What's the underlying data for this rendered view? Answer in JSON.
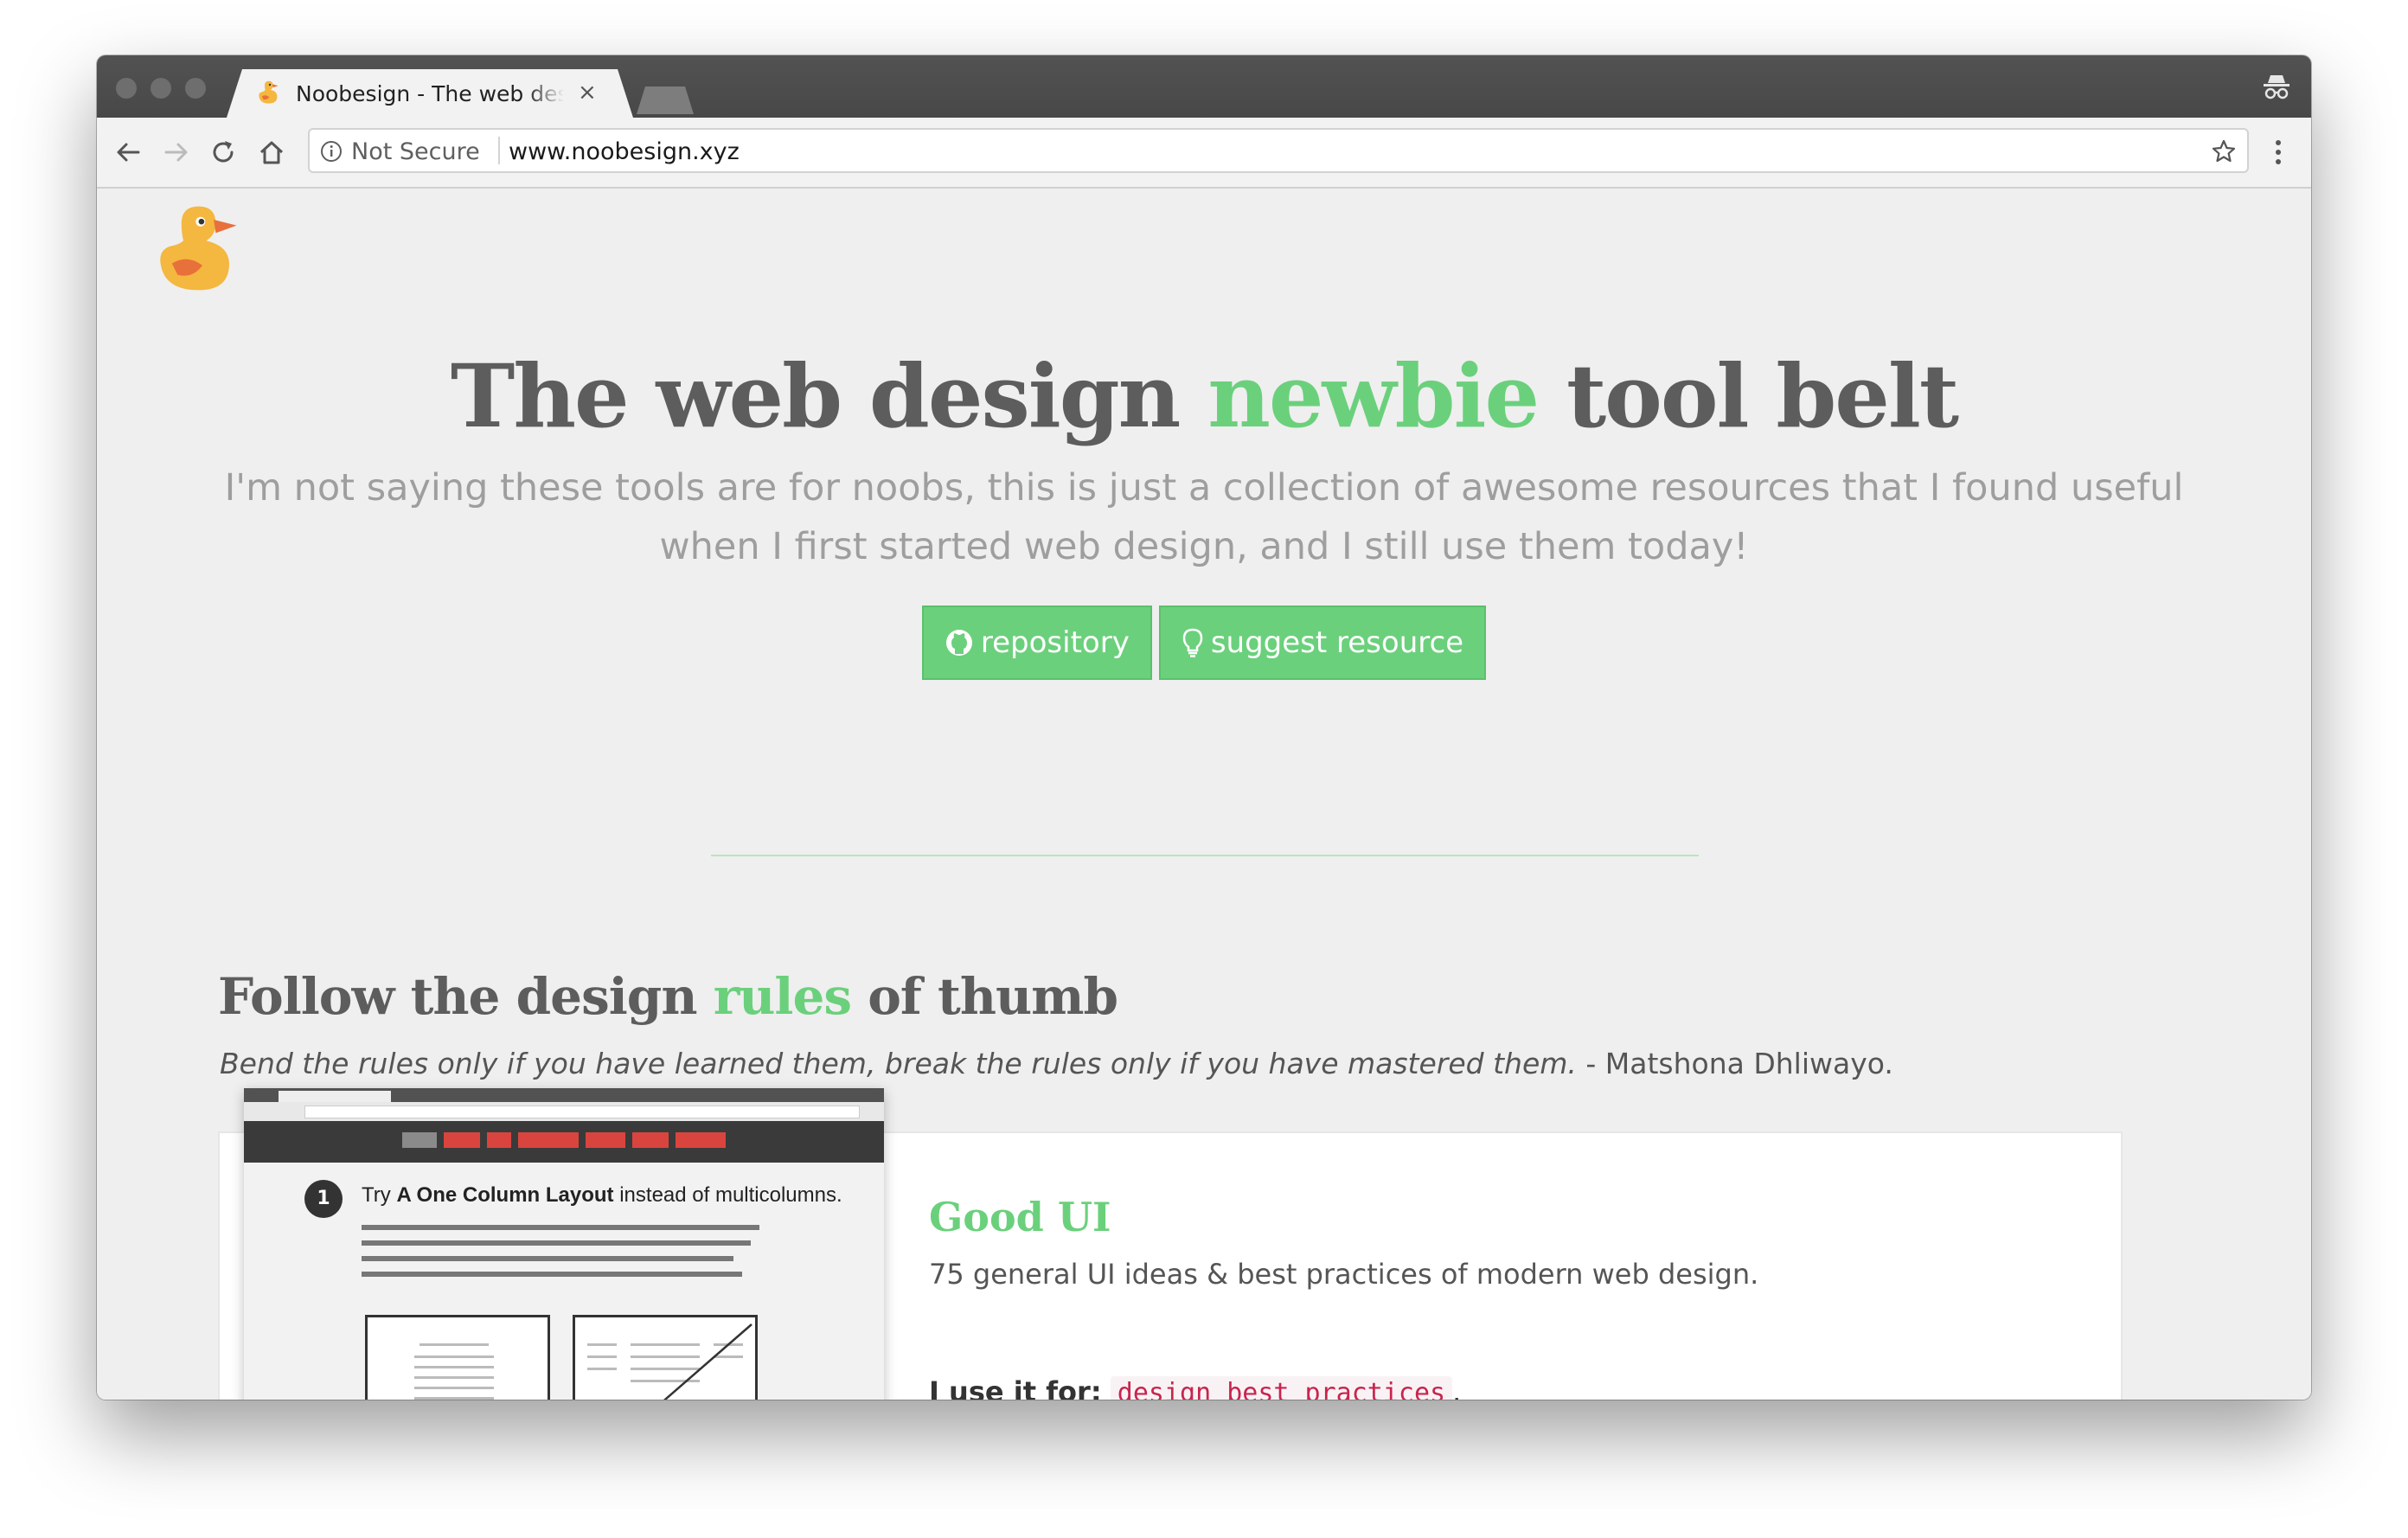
{
  "browser": {
    "tab_title": "Noobesign - The web design newbie tool belt",
    "tab_close_glyph": "×",
    "security_label": "Not Secure",
    "url": "www.noobesign.xyz",
    "icons": [
      "back-icon",
      "forward-icon",
      "reload-icon",
      "home-icon",
      "info-icon",
      "star-icon",
      "menu-icon",
      "incognito-icon",
      "close-icon"
    ]
  },
  "hero": {
    "title_part1": "The web design ",
    "title_highlight": "newbie",
    "title_part2": " tool belt",
    "subtitle": "I'm not saying these tools are for noobs, this is just a collection of awesome resources that I found useful when I first started web design, and I still use them today!",
    "buttons": [
      {
        "label": "repository",
        "icon": "github-icon"
      },
      {
        "label": "suggest resource",
        "icon": "lightbulb-icon"
      }
    ]
  },
  "section": {
    "title_part1": "Follow the design ",
    "title_highlight": "rules",
    "title_part2": " of thumb",
    "quote": "Bend the rules only if you have learned them, break the rules only if you have mastered them.",
    "quote_author": " - Matshona Dhliwayo."
  },
  "resource": {
    "title": "Good UI",
    "description": "75 general UI ideas & best practices of modern web design.",
    "use_label": "I use it for:",
    "tag": "design best practices",
    "tag_suffix": ".",
    "preview": {
      "idea_number": "1",
      "heading_prefix": "Try ",
      "heading_bold": "A One Column Layout",
      "heading_suffix": " instead of multicolumns."
    }
  },
  "colors": {
    "accent_green": "#6bd07c",
    "heading_gray": "#5d5d5d",
    "subtitle_gray": "#9e9e9e",
    "tag_red": "#c7254e"
  }
}
